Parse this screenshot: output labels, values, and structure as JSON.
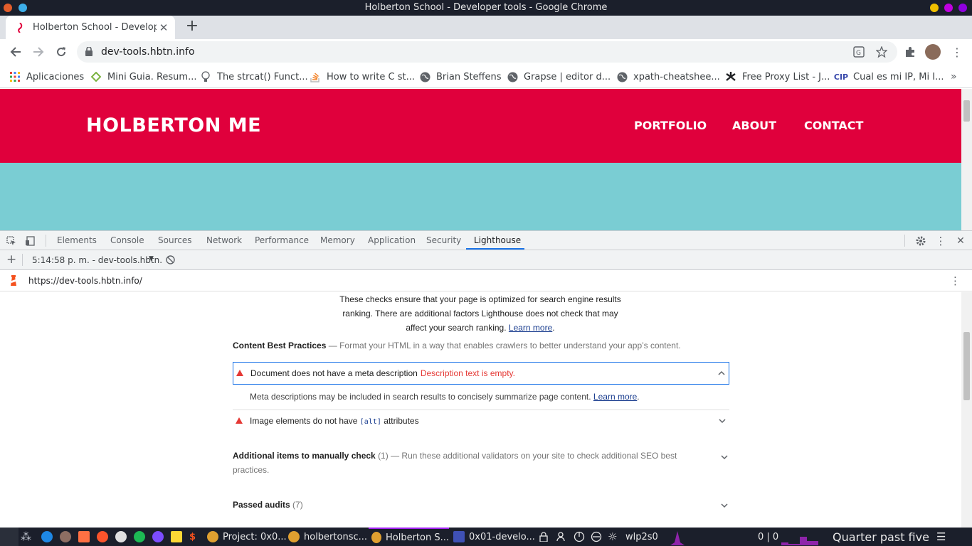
{
  "window": {
    "title": "Holberton School - Developer tools - Google Chrome",
    "traffic_colors": [
      "#f0c000",
      "#c000e0",
      "#9000e0"
    ]
  },
  "tabs": [
    {
      "title": "Holberton School - Developer tools",
      "active": true
    }
  ],
  "toolbar": {
    "url": "dev-tools.hbtn.info",
    "back_icon": "back-arrow-icon",
    "forward_icon": "forward-arrow-icon",
    "reload_icon": "reload-icon"
  },
  "bookmarks": [
    {
      "label": "Aplicaciones",
      "icon": "apps-grid-icon"
    },
    {
      "label": "Mini Guia. Resum...",
      "icon": "diamond-icon"
    },
    {
      "label": "The strcat() Funct...",
      "icon": "bulb-icon"
    },
    {
      "label": "How to write C st...",
      "icon": "stackoverflow-icon"
    },
    {
      "label": "Brian Steffens",
      "icon": "globe-icon"
    },
    {
      "label": "Grapse | editor d...",
      "icon": "globe-icon"
    },
    {
      "label": "xpath-cheatshee...",
      "icon": "globe-icon"
    },
    {
      "label": "Free Proxy List - J...",
      "icon": "star-logo-icon"
    },
    {
      "label": "Cual es mi IP, Mi I...",
      "icon": "cip-icon"
    }
  ],
  "site": {
    "logo": "HOLBERTON ME",
    "nav": [
      "PORTFOLIO",
      "ABOUT",
      "CONTACT"
    ],
    "header_color": "#e0003c",
    "hero_color": "#7acdd3"
  },
  "devtools": {
    "tabs": [
      "Elements",
      "Console",
      "Sources",
      "Network",
      "Performance",
      "Memory",
      "Application",
      "Security",
      "Lighthouse"
    ],
    "active_tab": "Lighthouse",
    "report_selector": "5:14:58 p. m. - dev-tools.hbtn.",
    "report_url": "https://dev-tools.hbtn.info/"
  },
  "report": {
    "intro_lines": [
      "These checks ensure that your page is optimized for search engine results",
      "ranking. There are additional factors Lighthouse does not check that may",
      "affect your search ranking."
    ],
    "intro_link": "Learn more",
    "content_group": {
      "title": "Content Best Practices",
      "desc": "Format your HTML in a way that enables crawlers to better understand your app’s content."
    },
    "audit_meta": {
      "title": "Document does not have a meta description",
      "warning": "Description text is empty.",
      "detail": "Meta descriptions may be included in search results to concisely summarize page content.",
      "detail_link": "Learn more"
    },
    "audit_alt": {
      "title_before": "Image elements do not have",
      "code": "[alt]",
      "title_after": "attributes"
    },
    "manual_group": {
      "title": "Additional items to manually check",
      "count": "(1)",
      "desc_line1": "Run these additional validators on your site to check additional SEO best",
      "desc_line2": "practices."
    },
    "passed_group": {
      "title": "Passed audits",
      "count": "(7)"
    }
  },
  "taskbar": {
    "windows": [
      {
        "label": "Project: 0x0...",
        "active": false
      },
      {
        "label": "holbertonsc...",
        "active": false
      },
      {
        "label": "Holberton S...",
        "active": true
      },
      {
        "label": "0x01-develo...",
        "active": false
      }
    ],
    "network_iface": "wlp2s0",
    "net_counters": "0 | 0",
    "clock": "Quarter past five"
  }
}
